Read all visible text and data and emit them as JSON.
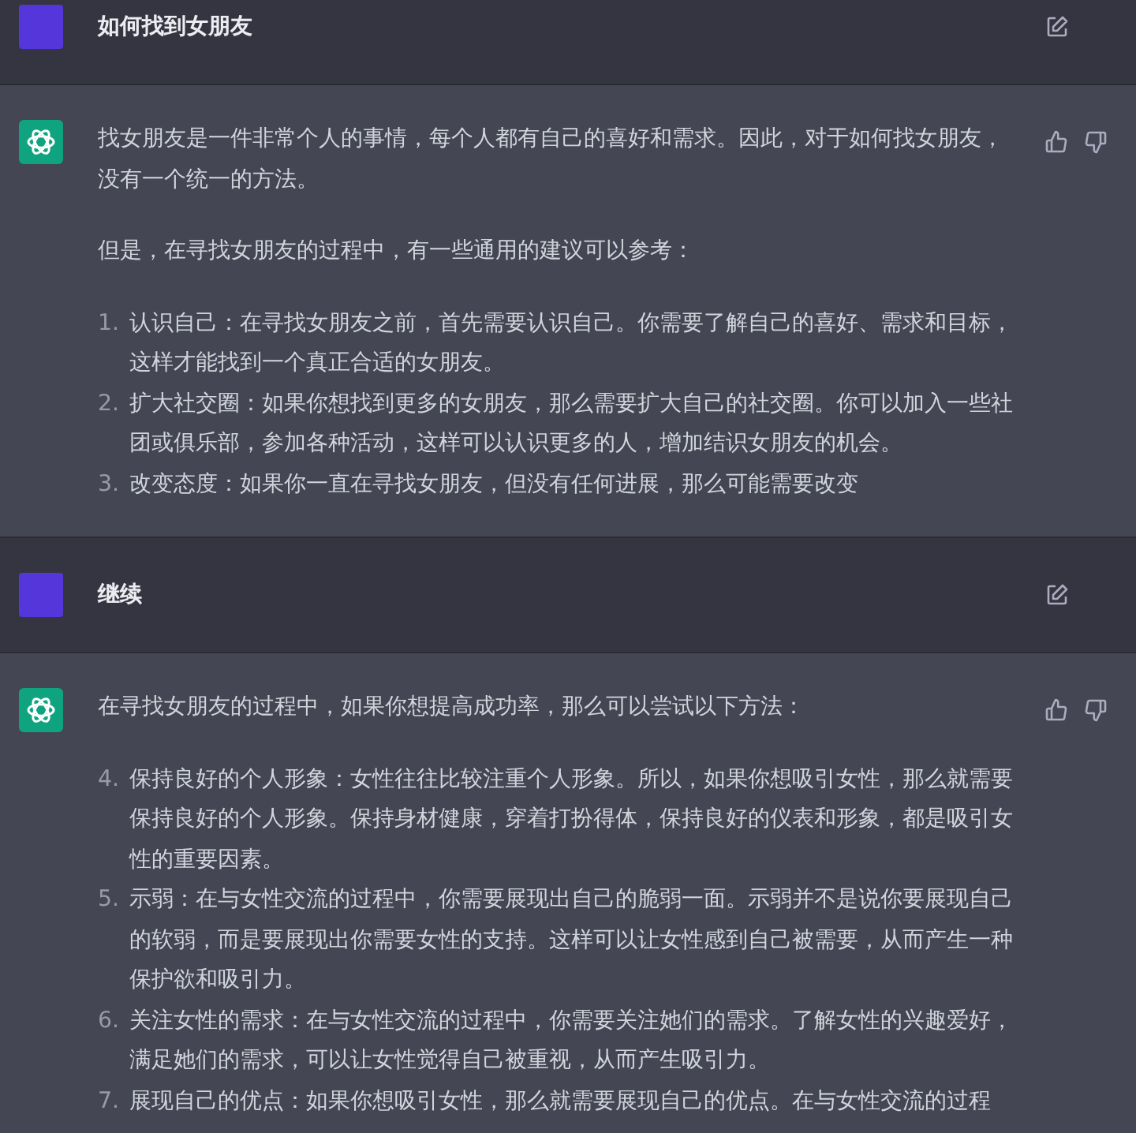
{
  "messages": [
    {
      "kind": "user",
      "text": "如何找到女朋友"
    },
    {
      "kind": "assistant",
      "blocks": [
        {
          "kind": "paragraph",
          "text": "找女朋友是一件非常个人的事情，每个人都有自己的喜好和需求。因此，对于如何找女朋友，没有一个统一的方法。"
        },
        {
          "kind": "paragraph",
          "text": "但是，在寻找女朋友的过程中，有一些通用的建议可以参考："
        },
        {
          "kind": "list",
          "items": [
            {
              "number": "1.",
              "text": "认识自己：在寻找女朋友之前，首先需要认识自己。你需要了解自己的喜好、需求和目标，这样才能找到一个真正合适的女朋友。"
            },
            {
              "number": "2.",
              "text": "扩大社交圈：如果你想找到更多的女朋友，那么需要扩大自己的社交圈。你可以加入一些社团或俱乐部，参加各种活动，这样可以认识更多的人，增加结识女朋友的机会。"
            },
            {
              "number": "3.",
              "text": "改变态度：如果你一直在寻找女朋友，但没有任何进展，那么可能需要改变"
            }
          ]
        }
      ]
    },
    {
      "kind": "user",
      "text": "继续"
    },
    {
      "kind": "assistant",
      "blocks": [
        {
          "kind": "paragraph",
          "text": "在寻找女朋友的过程中，如果你想提高成功率，那么可以尝试以下方法："
        },
        {
          "kind": "list",
          "items": [
            {
              "number": "4.",
              "text": "保持良好的个人形象：女性往往比较注重个人形象。所以，如果你想吸引女性，那么就需要保持良好的个人形象。保持身材健康，穿着打扮得体，保持良好的仪表和形象，都是吸引女性的重要因素。"
            },
            {
              "number": "5.",
              "text": "示弱：在与女性交流的过程中，你需要展现出自己的脆弱一面。示弱并不是说你要展现自己的软弱，而是要展现出你需要女性的支持。这样可以让女性感到自己被需要，从而产生一种保护欲和吸引力。"
            },
            {
              "number": "6.",
              "text": "关注女性的需求：在与女性交流的过程中，你需要关注她们的需求。了解女性的兴趣爱好，满足她们的需求，可以让女性觉得自己被重视，从而产生吸引力。"
            },
            {
              "number": "7.",
              "text": "展现自己的优点：如果你想吸引女性，那么就需要展现自己的优点。在与女性交流的过程"
            }
          ]
        }
      ]
    }
  ]
}
